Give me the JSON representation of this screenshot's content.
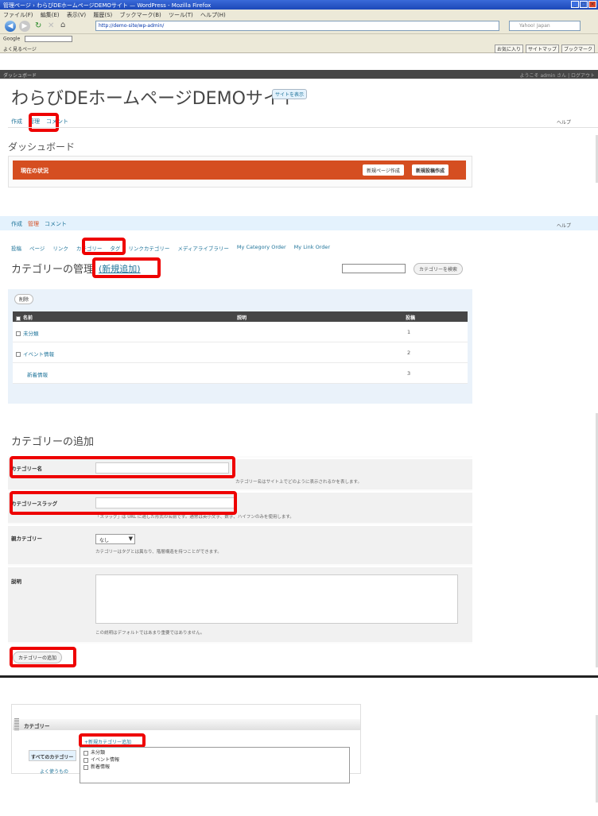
{
  "browser": {
    "title": "管理ページ › わらびDEホームページDEMOサイト — WordPress - Mozilla Firefox",
    "menu": [
      "ファイル(F)",
      "編集(E)",
      "表示(V)",
      "履歴(S)",
      "ブックマーク(B)",
      "ツール(T)",
      "ヘルプ(H)"
    ],
    "url": "http://demo-site/wp-admin/",
    "search_placeholder": "Yahoo! Japan",
    "google_label": "Google",
    "bookmarks_text": "よく見るページ",
    "right_buttons": [
      "お気に入り",
      "サイトマップ",
      "ブックマーク"
    ]
  },
  "adminbar": {
    "left": "ダッシュボード",
    "right": "ようこそ admin さん | ログアウト"
  },
  "site": {
    "title": "わらびDEホームページDEMOサイト",
    "visit_button": "サイトを表示",
    "menu": [
      "作成",
      "管理",
      "コメント"
    ],
    "help": "ヘルプ"
  },
  "dashboard": {
    "title": "ダッシュボード",
    "status_label": "現在の状況",
    "btn_new_page": "新規ページ作成",
    "btn_new_post": "新規投稿作成"
  },
  "manage": {
    "menu": [
      "作成",
      "管理",
      "コメント"
    ],
    "help": "ヘルプ",
    "submenu": [
      "投稿",
      "ページ",
      "リンク",
      "カテゴリー",
      "タグ",
      "リンクカテゴリー",
      "メディアライブラリー",
      "My Category Order",
      "My Link Order"
    ],
    "title": "カテゴリーの管理",
    "new_link": "(新規追加)",
    "search_button": "カテゴリーを検索",
    "bulk_button": "削除",
    "columns": [
      "名前",
      "説明",
      "投稿"
    ],
    "rows": [
      {
        "name": "未分類",
        "count": "1"
      },
      {
        "name": "イベント情報",
        "count": "2"
      },
      {
        "name": "新着情報",
        "count": "3"
      }
    ]
  },
  "add_form": {
    "title": "カテゴリーの追加",
    "name_label": "カテゴリー名",
    "name_note": "カテゴリー名はサイト上でどのように表示されるかを表します。",
    "slug_label": "カテゴリースラッグ",
    "slug_note": "「スラッグ」は URL に適した形式の名前です。通常は英小文字、数字、ハイフンのみを使用します。",
    "parent_label": "親カテゴリー",
    "parent_value": "なし",
    "parent_note": "カテゴリーはタグとは異なり、階層構造を持つことができます。",
    "desc_label": "説明",
    "desc_note": "この説明はデフォルトではあまり重要ではありません。",
    "submit": "カテゴリーの追加"
  },
  "metabox": {
    "title": "カテゴリー",
    "new_link": "+新規カテゴリー追加",
    "tab_all": "すべてのカテゴリー",
    "tab_popular": "よく使うもの",
    "items": [
      "未分類",
      "イベント情報",
      "新着情報"
    ]
  }
}
